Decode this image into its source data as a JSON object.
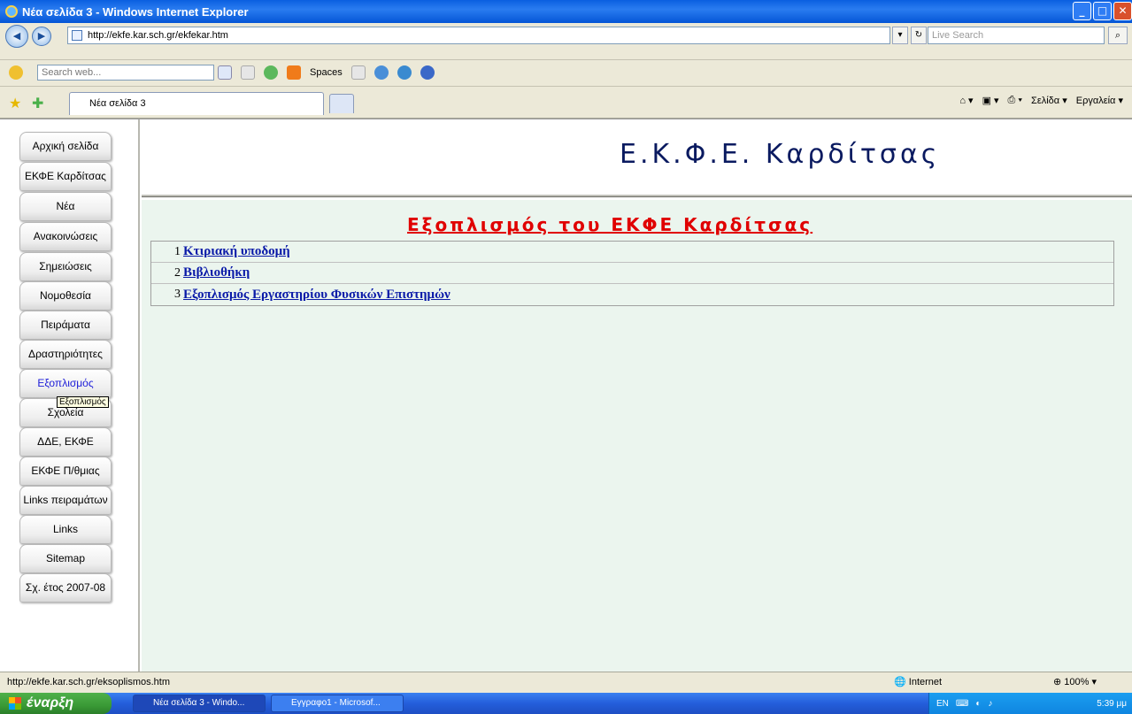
{
  "window": {
    "title": "Νέα σελίδα 3 - Windows Internet Explorer"
  },
  "address": {
    "url": "http://ekfe.kar.sch.gr/ekfekar.htm",
    "search_placeholder": "Live Search"
  },
  "toolbar": {
    "search_placeholder": "Search web...",
    "spaces_label": "Spaces"
  },
  "tabs": {
    "active_label": "Νέα σελίδα 3",
    "page_label": "Σελίδα",
    "tools_label": "Εργαλεία"
  },
  "sidebar": {
    "items": [
      {
        "label": "Αρχική σελίδα"
      },
      {
        "label": "ΕΚΦΕ Καρδίτσας"
      },
      {
        "label": "Νέα"
      },
      {
        "label": "Ανακοινώσεις"
      },
      {
        "label": "Σημειώσεις"
      },
      {
        "label": "Νομοθεσία"
      },
      {
        "label": "Πειράματα"
      },
      {
        "label": "Δραστηριότητες"
      },
      {
        "label": "Εξοπλισμός"
      },
      {
        "label": "Σχολεία"
      },
      {
        "label": "ΔΔΕ, ΕΚΦΕ"
      },
      {
        "label": "ΕΚΦΕ Π/θμιας"
      },
      {
        "label": "Links πειραμάτων"
      },
      {
        "label": "Links"
      },
      {
        "label": "Sitemap"
      },
      {
        "label": "Σχ. έτος 2007-08"
      }
    ],
    "tooltip": "Εξοπλισμός"
  },
  "header": {
    "title": "Ε.Κ.Φ.Ε. Καρδίτσας"
  },
  "main": {
    "heading": "Εξοπλισμός του ΕΚΦΕ Καρδίτσας",
    "items": [
      {
        "num": "1",
        "label": "Κτιριακή υποδομή"
      },
      {
        "num": "2",
        "label": "Βιβλιοθήκη"
      },
      {
        "num": "3",
        "label": "Εξοπλισμός Εργαστηρίου Φυσικών Επιστημών"
      }
    ]
  },
  "status": {
    "text": "http://ekfe.kar.sch.gr/eksoplismos.htm",
    "zone": "Internet",
    "zoom": "100%"
  },
  "taskbar": {
    "start_label": "έναρξη",
    "tasks": [
      {
        "label": "Νέα σελίδα 3 - Windo..."
      },
      {
        "label": "Εγγραφο1 - Microsof..."
      }
    ],
    "lang": "EN",
    "clock": "5:39 μμ"
  }
}
